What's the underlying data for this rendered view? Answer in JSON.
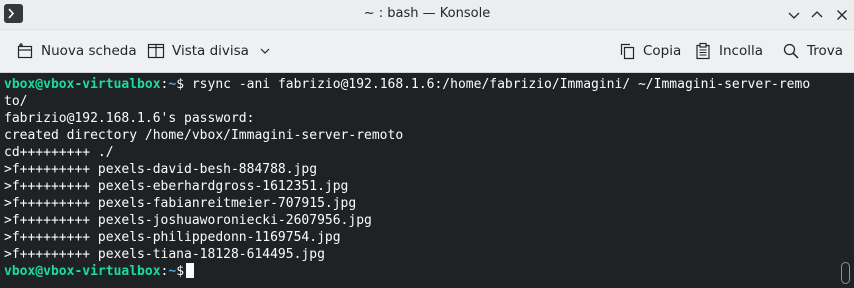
{
  "window": {
    "title": "~ : bash — Konsole",
    "app_icon": "konsole-icon"
  },
  "toolbar": {
    "new_tab_label": "Nuova scheda",
    "split_view_label": "Vista divisa",
    "copy_label": "Copia",
    "paste_label": "Incolla",
    "find_label": "Trova"
  },
  "terminal": {
    "prompt_user": "vbox@vbox-virtualbox",
    "prompt_sep": ":",
    "prompt_path": "~",
    "prompt_symbol": "$",
    "command_line_1": " rsync -ani fabrizio@192.168.1.6:/home/fabrizio/Immagini/ ~/Immagini-server-remo",
    "command_line_2": "to/",
    "output": [
      "fabrizio@192.168.1.6's password:",
      "created directory /home/vbox/Immagini-server-remoto",
      "cd+++++++++ ./",
      ">f+++++++++ pexels-david-besh-884788.jpg",
      ">f+++++++++ pexels-eberhardgross-1612351.jpg",
      ">f+++++++++ pexels-fabianreitmeier-707915.jpg",
      ">f+++++++++ pexels-joshuaworoniecki-2607956.jpg",
      ">f+++++++++ pexels-philippedonn-1169754.jpg",
      ">f+++++++++ pexels-tiana-18128-614495.jpg"
    ]
  },
  "colors": {
    "terminal_bg": "#1e2225",
    "prompt_user": "#1cdc9a",
    "prompt_path": "#3daee9",
    "text": "#fcfcfc"
  }
}
